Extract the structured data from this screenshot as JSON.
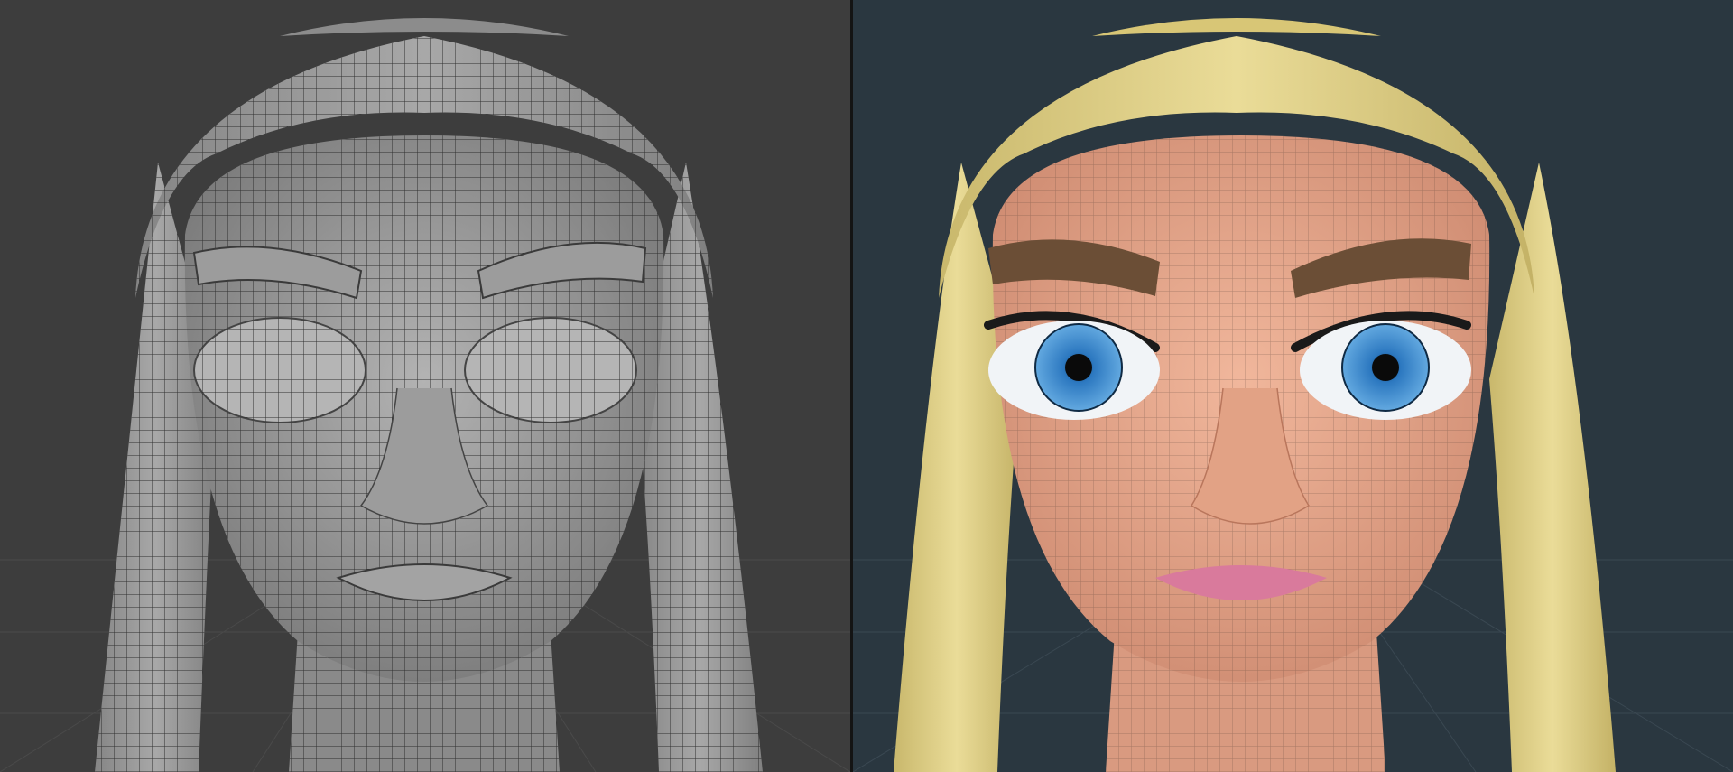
{
  "viewports": [
    {
      "id": "wireframe",
      "shading": "solid-wireframe",
      "background": "#3d3d3d",
      "mesh_color": "#9a9a9a",
      "wire_color": "#2f2f2f"
    },
    {
      "id": "material",
      "shading": "material-preview-wireframe",
      "background": "#2a3740",
      "skin": "#e7a98c",
      "hair": "#e6d68e",
      "brow": "#6b4e36",
      "iris": "#3a86c8",
      "lips": "#d97a9c",
      "wire_color": "#4a3a30"
    }
  ],
  "icons": [
    "grid-floor-icon",
    "head-model-icon"
  ]
}
